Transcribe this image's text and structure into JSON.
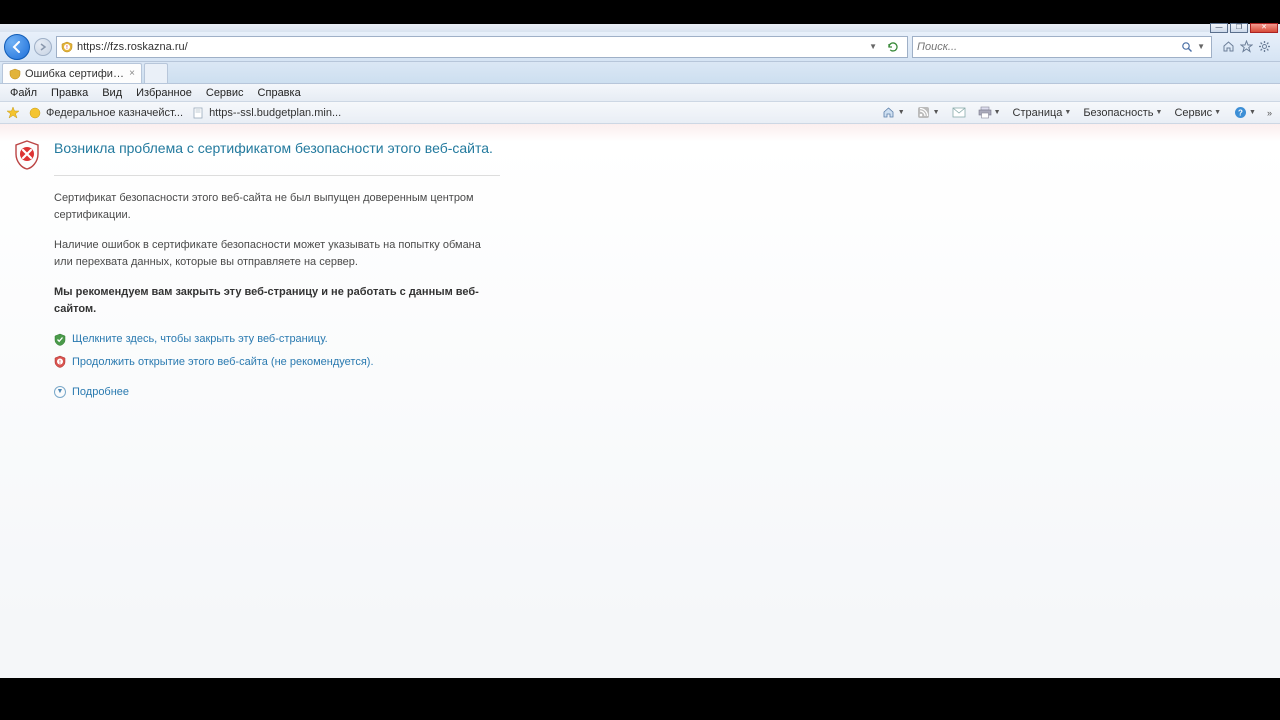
{
  "window": {
    "controls": {
      "min": "—",
      "max": "❐",
      "close": "✕"
    }
  },
  "navbar": {
    "url": "https://fzs.roskazna.ru/",
    "search_placeholder": "Поиск..."
  },
  "tab": {
    "title": "Ошибка сертификата: пе..."
  },
  "menu": {
    "file": "Файл",
    "edit": "Правка",
    "view": "Вид",
    "favorites": "Избранное",
    "tools": "Сервис",
    "help": "Справка"
  },
  "favorites": {
    "item1": "Федеральное казначейст...",
    "item2": "https--ssl.budgetplan.min..."
  },
  "commandbar": {
    "page": "Страница",
    "safety": "Безопасность",
    "service": "Сервис"
  },
  "cert": {
    "title": "Возникла проблема с сертификатом безопасности этого веб-сайта.",
    "p1": "Сертификат безопасности этого веб-сайта не был выпущен доверенным центром сертификации.",
    "p2": "Наличие ошибок в сертификате безопасности может указывать на попытку обмана или перехвата данных, которые вы отправляете на сервер.",
    "p3": "Мы рекомендуем вам закрыть эту веб-страницу и не работать с данным веб-сайтом.",
    "close_link": "Щелкните здесь, чтобы закрыть эту веб-страницу.",
    "continue_link": "Продолжить открытие этого веб-сайта (не рекомендуется).",
    "more": "Подробнее"
  }
}
